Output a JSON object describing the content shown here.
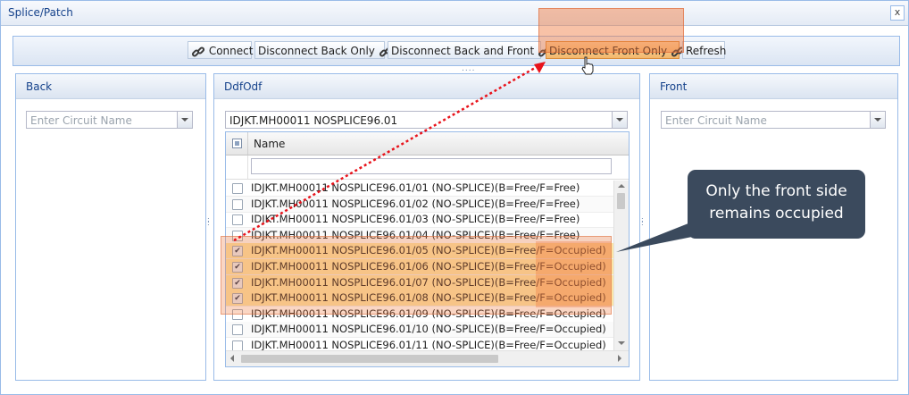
{
  "window": {
    "title": "Splice/Patch",
    "close_label": "x"
  },
  "toolbar": {
    "buttons": [
      {
        "label": "Connect",
        "icon": "link-icon"
      },
      {
        "label": "Disconnect Back Only",
        "icon": "link-icon"
      },
      {
        "label": "Disconnect Back and Front",
        "icon": "link-icon"
      },
      {
        "label": "Disconnect Front Only",
        "icon": "link-icon",
        "active": true
      },
      {
        "label": "Refresh"
      }
    ],
    "splitter": "....",
    "highlight_color": "#f07840"
  },
  "back": {
    "title": "Back",
    "placeholder": "Enter Circuit Name"
  },
  "front": {
    "title": "Front",
    "placeholder": "Enter Circuit Name"
  },
  "ddf": {
    "title": "DdfOdf",
    "selected_value": "IDJKT.MH00011 NOSPLICE96.01",
    "column_name": "Name",
    "rows": [
      {
        "name": "IDJKT.MH00011 NOSPLICE96.01/01 (NO-SPLICE)(B=Free/F=Free)",
        "checked": false
      },
      {
        "name": "IDJKT.MH00011 NOSPLICE96.01/02 (NO-SPLICE)(B=Free/F=Free)",
        "checked": false
      },
      {
        "name": "IDJKT.MH00011 NOSPLICE96.01/03 (NO-SPLICE)(B=Free/F=Free)",
        "checked": false
      },
      {
        "name": "IDJKT.MH00011 NOSPLICE96.01/04 (NO-SPLICE)(B=Free/F=Free)",
        "checked": false
      },
      {
        "name": "IDJKT.MH00011 NOSPLICE96.01/05 (NO-SPLICE)(B=Free/F=Occupied)",
        "checked": true
      },
      {
        "name": "IDJKT.MH00011 NOSPLICE96.01/06 (NO-SPLICE)(B=Free/F=Occupied)",
        "checked": true
      },
      {
        "name": "IDJKT.MH00011 NOSPLICE96.01/07 (NO-SPLICE)(B=Free/F=Occupied)",
        "checked": true
      },
      {
        "name": "IDJKT.MH00011 NOSPLICE96.01/08 (NO-SPLICE)(B=Free/F=Occupied)",
        "checked": true
      },
      {
        "name": "IDJKT.MH00011 NOSPLICE96.01/09 (NO-SPLICE)(B=Free/F=Occupied)",
        "checked": false
      },
      {
        "name": "IDJKT.MH00011 NOSPLICE96.01/10 (NO-SPLICE)(B=Free/F=Occupied)",
        "checked": false
      },
      {
        "name": "IDJKT.MH00011 NOSPLICE96.01/11 (NO-SPLICE)(B=Free/F=Occupied)",
        "checked": false
      }
    ]
  },
  "callout": {
    "line1": "Only the front side",
    "line2": "remains occupied",
    "color": "#3b4a5d"
  },
  "arrow_color": "#e8131b"
}
